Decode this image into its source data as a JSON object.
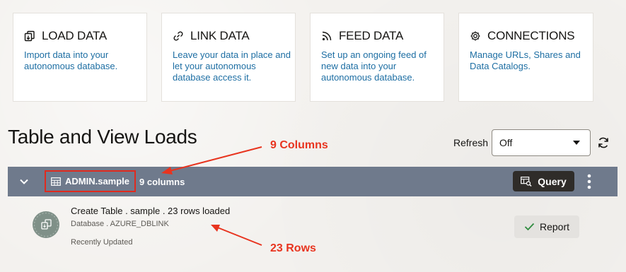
{
  "cards": [
    {
      "title": "LOAD DATA",
      "desc": "Import data into your autonomous database.",
      "icon": "load-data-icon"
    },
    {
      "title": "LINK DATA",
      "desc": "Leave your data in place and let your autonomous database access it.",
      "icon": "link-icon"
    },
    {
      "title": "FEED DATA",
      "desc": "Set up an ongoing feed of new data into your autonomous database.",
      "icon": "feed-icon"
    },
    {
      "title": "CONNECTIONS",
      "desc": "Manage URLs, Shares and Data Catalogs.",
      "icon": "gear-icon"
    }
  ],
  "section": {
    "title": "Table and View Loads",
    "refresh_label": "Refresh",
    "refresh_value": "Off"
  },
  "load": {
    "object_name": "ADMIN.sample",
    "column_count": "9 columns",
    "query_label": "Query",
    "item_title": "Create Table . sample . 23 rows loaded",
    "item_subtitle": "Database . AZURE_DBLINK",
    "item_status": "Recently Updated",
    "report_label": "Report"
  },
  "annotations": {
    "columns": "9 Columns",
    "rows": "23 Rows"
  },
  "colors": {
    "link": "#1d6ea3",
    "bar": "#6f7a8c",
    "annotation": "#e8341f",
    "query_button": "#2f2c29"
  }
}
